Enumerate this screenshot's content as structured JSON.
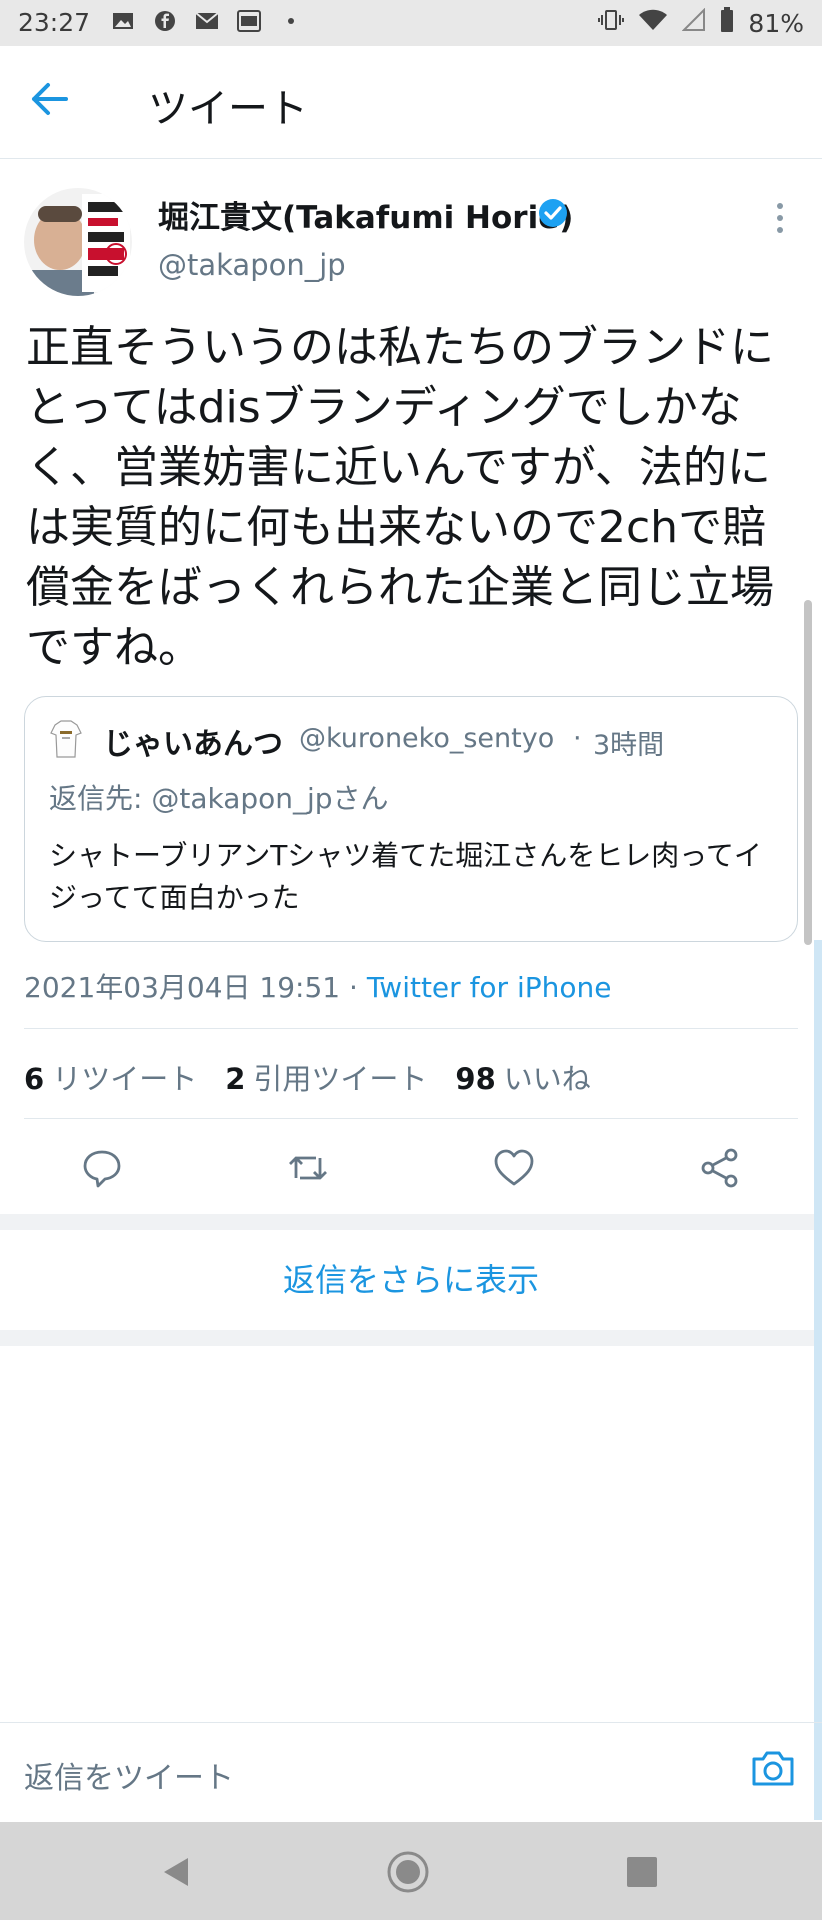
{
  "status_bar": {
    "time": "23:27",
    "battery": "81%"
  },
  "header": {
    "title": "ツイート"
  },
  "tweet": {
    "author_name": "堀江貴文(Takafumi Horie)",
    "author_handle": "@takapon_jp",
    "text": "正直そういうのは私たちのブランドにとってはdisブランディングでしかなく、営業妨害に近いんですが、法的には実質的に何も出来ないので2chで賠償金をばっくれられた企業と同じ立場ですね。",
    "timestamp": "2021年03月04日 19:51",
    "source": "Twitter for iPhone",
    "retweets": "6",
    "retweets_label": "リツイート",
    "quotes": "2",
    "quotes_label": "引用ツイート",
    "likes": "98",
    "likes_label": "いいね"
  },
  "quoted": {
    "name": "じゃいあんつ",
    "handle": "@kuroneko_sentyo",
    "dot": "·",
    "time": "3時間",
    "reply_to": "返信先: @takapon_jpさん",
    "text": "シャトーブリアンTシャツ着てた堀江さんをヒレ肉ってイジってて面白かった"
  },
  "show_more": "返信をさらに表示",
  "reply_placeholder": "返信をツイート",
  "colors": {
    "accent": "#1b95e0",
    "secondary": "#657786",
    "border": "#e1e8ed"
  },
  "icons": [
    "back-arrow-icon",
    "verified-icon",
    "more-vertical-icon",
    "reply-icon",
    "retweet-icon",
    "like-icon",
    "share-icon",
    "camera-icon"
  ]
}
